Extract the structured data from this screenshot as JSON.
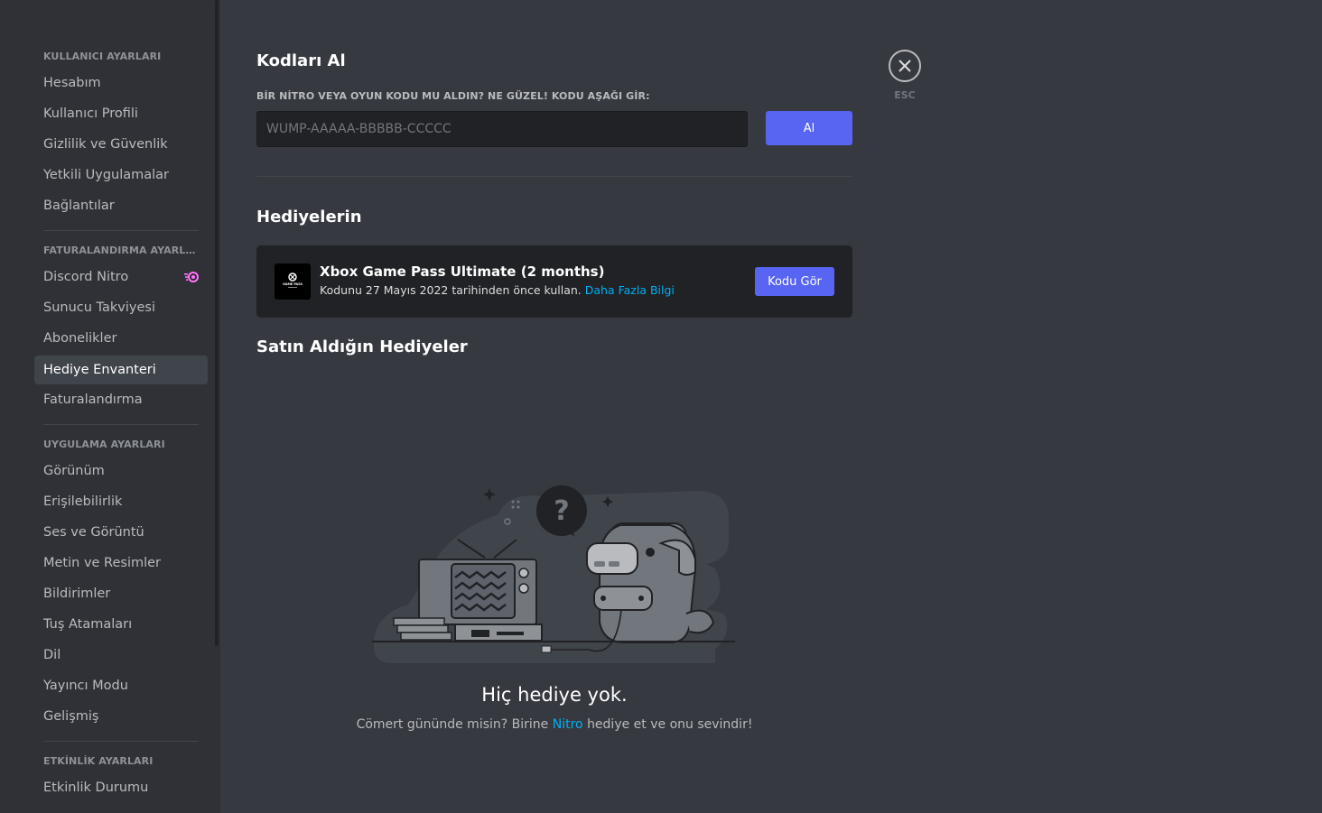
{
  "sidebar": {
    "sections": [
      {
        "header": "KULLANICI AYARLARI",
        "items": [
          "Hesabım",
          "Kullanıcı Profili",
          "Gizlilik ve Güvenlik",
          "Yetkili Uygulamalar",
          "Bağlantılar"
        ]
      },
      {
        "header": "FATURALANDIRMA AYARLARI",
        "items": [
          "Discord Nitro",
          "Sunucu Takviyesi",
          "Abonelikler",
          "Hediye Envanteri",
          "Faturalandırma"
        ]
      },
      {
        "header": "UYGULAMA AYARLARI",
        "items": [
          "Görünüm",
          "Erişilebilirlik",
          "Ses ve Görüntü",
          "Metin ve Resimler",
          "Bildirimler",
          "Tuş Atamaları",
          "Dil",
          "Yayıncı Modu",
          "Gelişmiş"
        ]
      },
      {
        "header": "ETKİNLİK AYARLARI",
        "items": [
          "Etkinlik Durumu"
        ]
      }
    ],
    "active_item": "Hediye Envanteri"
  },
  "redeem": {
    "title": "Kodları Al",
    "label": "BİR NİTRO VEYA OYUN KODU MU ALDIN? NE GÜZEL! KODU AŞAĞI GİR:",
    "placeholder": "WUMP-AAAAA-BBBBB-CCCCC",
    "button": "Al"
  },
  "gifts": {
    "title": "Hediyelerin",
    "items": [
      {
        "name": "Xbox Game Pass Ultimate (2 months)",
        "description": "Kodunu 27 Mayıs 2022 tarihinden önce kullan.",
        "link": "Daha Fazla Bilgi",
        "button": "Kodu Gör",
        "logo_text": "GAME PASS"
      }
    ]
  },
  "purchased": {
    "title": "Satın Aldığın Hediyeler",
    "empty_title": "Hiç hediye yok.",
    "empty_prefix": "Cömert gününde misin? Birine",
    "empty_link": "Nitro",
    "empty_suffix": "hediye et ve onu sevindir!"
  },
  "close": {
    "label": "ESC"
  },
  "colors": {
    "accent": "#5865f2",
    "link": "#00aff4",
    "nitro": "#ff73fa"
  }
}
